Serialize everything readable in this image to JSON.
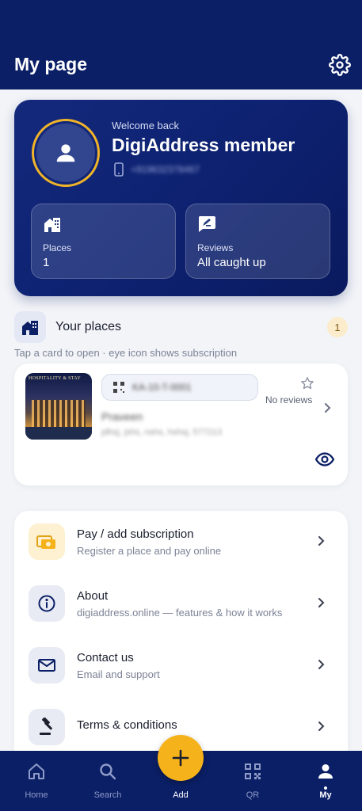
{
  "header": {
    "title": "My page",
    "settings_icon": "gear-icon"
  },
  "profile": {
    "welcome": "Welcome back",
    "name": "DigiAddress member",
    "phone": "+919632378467",
    "avatar_icon": "person-icon",
    "ring_color": "#f0b429",
    "stats": [
      {
        "label": "Places",
        "value": "1",
        "icon": "building-icon"
      },
      {
        "label": "Reviews",
        "value": "All caught up",
        "icon": "review-icon"
      }
    ]
  },
  "places": {
    "title": "Your places",
    "count": "1",
    "hint": "Tap a card to open · eye icon shows subscription",
    "items": [
      {
        "thumbnail_text": "HOSPITALITY & STAY",
        "code": "KA-10-T-0001",
        "reviews": "No reviews",
        "owner": "Praveen",
        "address": "jdhsj, jshs, nshs, hshsj, 577213"
      }
    ]
  },
  "menu": {
    "items": [
      {
        "title": "Pay / add subscription",
        "subtitle": "Register a place and pay online",
        "icon": "payment-icon"
      },
      {
        "title": "About",
        "subtitle": "digiaddress.online — features & how it works",
        "icon": "info-icon"
      },
      {
        "title": "Contact us",
        "subtitle": "Email and support",
        "icon": "mail-icon"
      },
      {
        "title": "Terms & conditions",
        "subtitle": "",
        "icon": "gavel-icon"
      }
    ]
  },
  "nav": {
    "items": [
      {
        "label": "Home",
        "icon": "home-icon"
      },
      {
        "label": "Search",
        "icon": "search-icon"
      },
      {
        "label": "Add",
        "icon": "plus-icon"
      },
      {
        "label": "QR",
        "icon": "qr-icon"
      },
      {
        "label": "My",
        "icon": "person-icon",
        "active": true
      }
    ]
  },
  "colors": {
    "primary": "#0b1f66",
    "accent": "#f6b21a",
    "background": "#f2f4f8"
  }
}
